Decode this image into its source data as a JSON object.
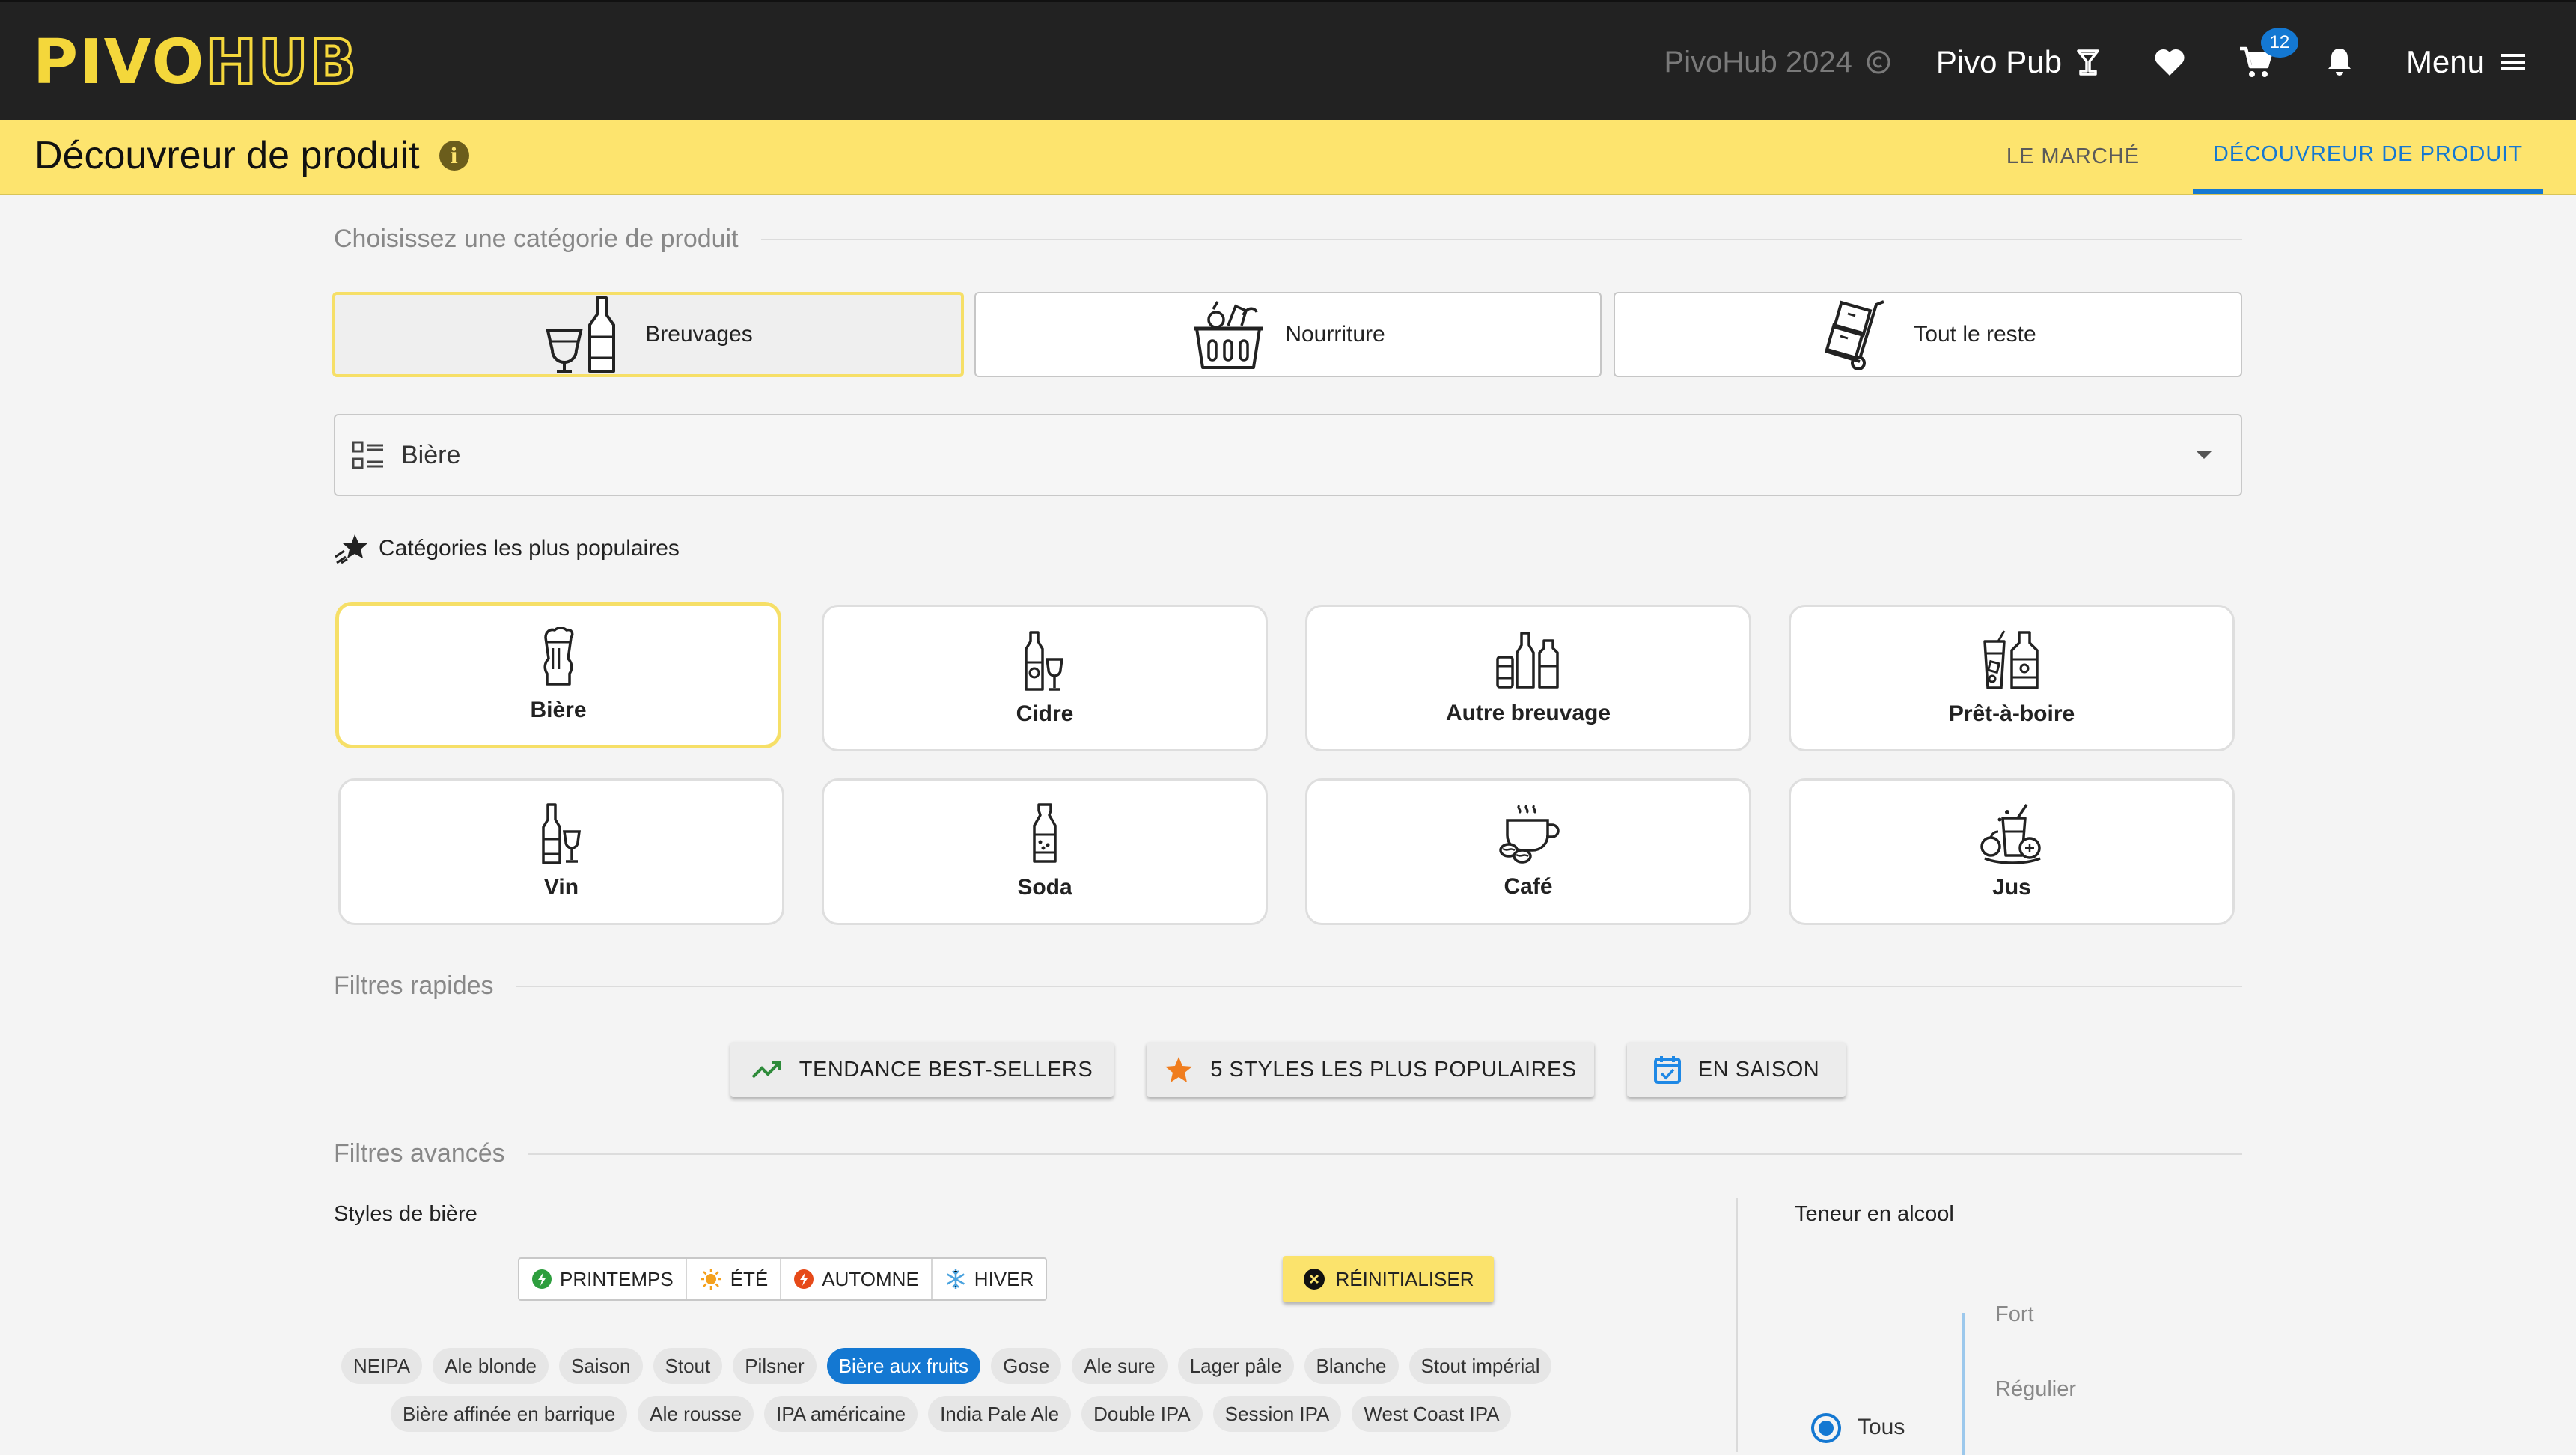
{
  "app": {
    "logo_part1": "PIVO",
    "logo_part2": "HUB",
    "year_text": "PivoHub 2024",
    "pub_name": "Pivo Pub",
    "cart_count": "12",
    "menu_label": "Menu"
  },
  "page": {
    "title": "Découvreur de produit",
    "tabs": [
      {
        "label": "LE MARCHÉ",
        "active": false
      },
      {
        "label": "DÉCOUVREUR DE PRODUIT",
        "active": true
      }
    ]
  },
  "category_section": {
    "label": "Choisissez une catégorie de produit",
    "buttons": [
      {
        "label": "Breuvages",
        "icon": "wine-bottle-icon",
        "selected": true
      },
      {
        "label": "Nourriture",
        "icon": "food-basket-icon",
        "selected": false
      },
      {
        "label": "Tout le reste",
        "icon": "hand-truck-icon",
        "selected": false
      }
    ]
  },
  "select": {
    "value": "Bière",
    "icon": "list-icon"
  },
  "popular": {
    "title": "Catégories les plus populaires",
    "items": [
      {
        "label": "Bière",
        "icon": "beer-glass-icon",
        "selected": true
      },
      {
        "label": "Cidre",
        "icon": "cider-bottle-icon",
        "selected": false
      },
      {
        "label": "Autre breuvage",
        "icon": "bottles-icon",
        "selected": false
      },
      {
        "label": "Prêt-à-boire",
        "icon": "ready-to-drink-icon",
        "selected": false
      },
      {
        "label": "Vin",
        "icon": "wine-icon",
        "selected": false
      },
      {
        "label": "Soda",
        "icon": "soda-bottle-icon",
        "selected": false
      },
      {
        "label": "Café",
        "icon": "coffee-cup-icon",
        "selected": false
      },
      {
        "label": "Jus",
        "icon": "juice-icon",
        "selected": false
      }
    ]
  },
  "quick_filters": {
    "label": "Filtres rapides",
    "buttons": [
      {
        "label": "TENDANCE BEST-SELLERS",
        "icon": "trending-up-icon",
        "color": "#2e8b3a"
      },
      {
        "label": "5 STYLES LES PLUS POPULAIRES",
        "icon": "star-icon",
        "color": "#f07d1e"
      },
      {
        "label": "EN SAISON",
        "icon": "calendar-check-icon",
        "color": "#1e88e5"
      }
    ]
  },
  "advanced": {
    "label": "Filtres avancés",
    "styles_title": "Styles de bière",
    "seasons": [
      {
        "label": "PRINTEMPS",
        "icon": "spring-icon",
        "color": "#2e9e3e"
      },
      {
        "label": "ÉTÉ",
        "icon": "sun-icon",
        "color": "#f4a01c"
      },
      {
        "label": "AUTOMNE",
        "icon": "autumn-icon",
        "color": "#e64a19"
      },
      {
        "label": "HIVER",
        "icon": "snowflake-icon",
        "color": "#4aa3df"
      }
    ],
    "reset_label": "RÉINITIALISER",
    "chips_row1": [
      "NEIPA",
      "Ale blonde",
      "Saison",
      "Stout",
      "Pilsner",
      "Bière aux fruits",
      "Gose",
      "Ale sure",
      "Lager pâle",
      "Blanche",
      "Stout impérial"
    ],
    "chips_row2": [
      "Bière affinée en barrique",
      "Ale rousse",
      "IPA américaine",
      "India Pale Ale",
      "Double IPA",
      "Session IPA",
      "West Coast IPA"
    ],
    "active_chip": "Bière aux fruits",
    "alcohol": {
      "title": "Teneur en alcool",
      "levels": [
        "Fort",
        "Régulier"
      ],
      "radio_label": "Tous"
    }
  },
  "colors": {
    "accent": "#1478d2",
    "yellow": "#fde46e",
    "dark": "#222222"
  }
}
